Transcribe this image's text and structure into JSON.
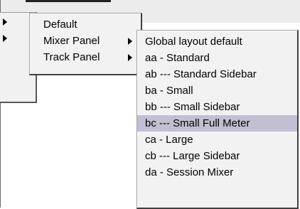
{
  "menu_main": {
    "items": [
      {
        "label": "Default",
        "has_submenu": false
      },
      {
        "label": "Mixer Panel",
        "has_submenu": true
      },
      {
        "label": "Track Panel",
        "has_submenu": true
      }
    ]
  },
  "submenu_mixer": {
    "items": [
      {
        "label": "Global layout default"
      },
      {
        "label": "aa - Standard"
      },
      {
        "label": "ab --- Standard Sidebar"
      },
      {
        "label": "ba - Small"
      },
      {
        "label": "bb --- Small Sidebar"
      },
      {
        "label": "bc --- Small Full Meter",
        "highlighted": true
      },
      {
        "label": "ca - Large"
      },
      {
        "label": "cb --- Large Sidebar"
      },
      {
        "label": "da - Session Mixer"
      }
    ]
  },
  "colors": {
    "highlight": "#c2bfd2",
    "menu_bg": "#f2f2f2"
  }
}
